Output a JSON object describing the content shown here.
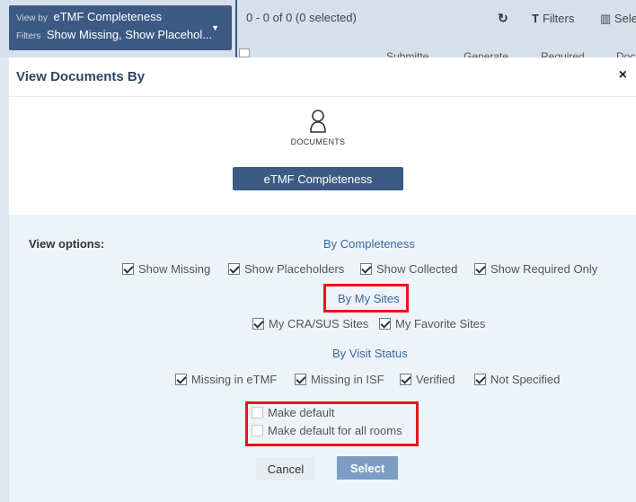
{
  "topbar": {
    "viewby_label": "View by",
    "viewby_value": "eTMF Completeness",
    "filters_label": "Filters",
    "filters_value": "Show Missing, Show Placehol...",
    "records": "0 - 0 of 0 (0 selected)",
    "filters_button": "Filters",
    "select_button": "Sele",
    "columns": [
      "Submitte",
      "Generate",
      "Required",
      "Doc"
    ]
  },
  "dialog": {
    "title": "View Documents By",
    "close": "×",
    "doc_caption": "DOCUMENTS",
    "etmf_button": "eTMF Completeness",
    "view_options_label": "View options:",
    "groups": {
      "completeness": {
        "title": "By Completeness",
        "options": [
          {
            "label": "Show Missing",
            "checked": true
          },
          {
            "label": "Show Placeholders",
            "checked": true
          },
          {
            "label": "Show Collected",
            "checked": true
          },
          {
            "label": "Show Required Only",
            "checked": true
          }
        ]
      },
      "sites": {
        "title": "By My Sites",
        "options": [
          {
            "label": "My CRA/SUS Sites",
            "checked": true
          },
          {
            "label": "My Favorite Sites",
            "checked": true
          }
        ]
      },
      "visit": {
        "title": "By Visit Status",
        "options": [
          {
            "label": "Missing in eTMF",
            "checked": true
          },
          {
            "label": "Missing in ISF",
            "checked": true
          },
          {
            "label": "Verified",
            "checked": true
          },
          {
            "label": "Not Specified",
            "checked": true
          }
        ]
      }
    },
    "defaults": {
      "make_default": "Make default",
      "make_default_all": "Make default for all rooms"
    },
    "cancel": "Cancel",
    "select": "Select"
  },
  "colors": {
    "primary": "#3d5a84",
    "link": "#3a67a5",
    "highlight": "#e8141a",
    "select_button": "#7d9dc5"
  }
}
